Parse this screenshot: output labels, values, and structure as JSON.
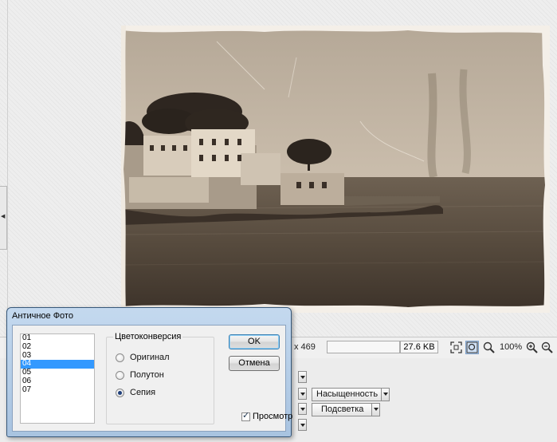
{
  "image": {
    "alt": "Sepia toned photo of a seaside village with houses, trees and calm water, with worn photo borders"
  },
  "status_bar": {
    "dimensions": "x 469",
    "file_size": "27.6 KB",
    "zoom": "100%"
  },
  "bottom_tools": {
    "saturation_label": "Насыщенность",
    "backlight_label": "Подсветка"
  },
  "dialog": {
    "title": "Античное Фото",
    "presets": [
      "01",
      "02",
      "03",
      "04",
      "05",
      "06",
      "07"
    ],
    "selected_preset_index": 3,
    "color_conversion": {
      "legend": "Цветоконверсия",
      "options": [
        "Оригинал",
        "Полутон",
        "Сепия"
      ],
      "selected": "Сепия"
    },
    "ok_label": "OK",
    "cancel_label": "Отмена",
    "preview_label": "Просмотр",
    "preview_checked": true
  },
  "icons": {
    "fit": "fit-to-window-icon",
    "zoom_actual": "zoom-actual-icon",
    "zoom_mode": "zoom-mode-icon",
    "zoom_in": "zoom-in-icon",
    "zoom_out": "zoom-out-icon"
  },
  "colors": {
    "sepia_light": "#c4b6a4",
    "sepia_dark": "#3a2f25",
    "selection": "#3399ff",
    "dialog_frame": "#a8c3e0"
  }
}
